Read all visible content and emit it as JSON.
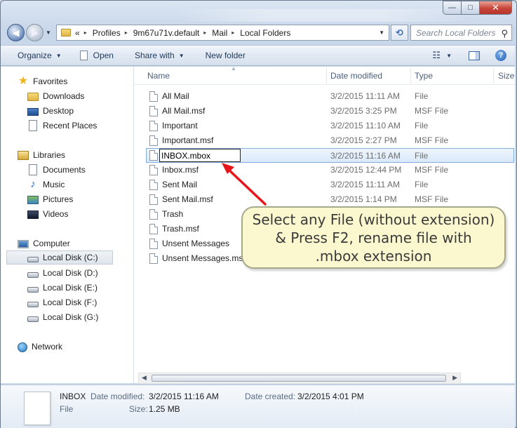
{
  "window": {
    "caption": {
      "minimize": "—",
      "maximize": "□",
      "close": "✕"
    }
  },
  "address_bar": {
    "crumbs": [
      "Profiles",
      "9m67u71v.default",
      "Mail",
      "Local Folders"
    ],
    "prefix": "«",
    "search_placeholder": "Search Local Folders"
  },
  "command_bar": {
    "organize": "Organize",
    "open": "Open",
    "share_with": "Share with",
    "new_folder": "New folder"
  },
  "nav_pane": {
    "favorites": {
      "label": "Favorites",
      "items": [
        "Downloads",
        "Desktop",
        "Recent Places"
      ]
    },
    "libraries": {
      "label": "Libraries",
      "items": [
        "Documents",
        "Music",
        "Pictures",
        "Videos"
      ]
    },
    "computer": {
      "label": "Computer",
      "items": [
        "Local Disk (C:)",
        "Local Disk (D:)",
        "Local Disk (E:)",
        "Local Disk (F:)",
        "Local Disk (G:)"
      ],
      "selected": "Local Disk (C:)"
    },
    "network": {
      "label": "Network"
    }
  },
  "columns": {
    "name": "Name",
    "date_modified": "Date modified",
    "type": "Type",
    "size": "Size"
  },
  "files": [
    {
      "name": "All Mail",
      "date": "3/2/2015 11:11 AM",
      "type": "File"
    },
    {
      "name": "All Mail.msf",
      "date": "3/2/2015 3:25 PM",
      "type": "MSF File"
    },
    {
      "name": "Important",
      "date": "3/2/2015 11:10 AM",
      "type": "File"
    },
    {
      "name": "Important.msf",
      "date": "3/2/2015 2:27 PM",
      "type": "MSF File"
    },
    {
      "name": "INBOX.mbox",
      "date": "3/2/2015 11:16 AM",
      "type": "File"
    },
    {
      "name": "Inbox.msf",
      "date": "3/2/2015 12:44 PM",
      "type": "MSF File"
    },
    {
      "name": "Sent Mail",
      "date": "3/2/2015 11:11 AM",
      "type": "File"
    },
    {
      "name": "Sent Mail.msf",
      "date": "3/2/2015 1:14 PM",
      "type": "MSF File"
    },
    {
      "name": "Trash",
      "date": "",
      "type": ""
    },
    {
      "name": "Trash.msf",
      "date": "",
      "type": ""
    },
    {
      "name": "Unsent Messages",
      "date": "",
      "type": ""
    },
    {
      "name": "Unsent Messages.msf",
      "date": "",
      "type": ""
    }
  ],
  "details_pane": {
    "name": "INBOX",
    "type": "File",
    "date_modified_label": "Date modified:",
    "date_modified": "3/2/2015 11:16 AM",
    "date_created_label": "Date created:",
    "date_created": "3/2/2015 4:01 PM",
    "size_label": "Size:",
    "size": "1.25 MB"
  },
  "callout": {
    "text": "Select any File (without extension) & Press F2, rename file with .mbox extension",
    "line1": "Select any File (without extension)",
    "line2": "& Press F2, rename file with",
    "line3": ".mbox extension",
    "arrow_color": "#e8141c"
  }
}
